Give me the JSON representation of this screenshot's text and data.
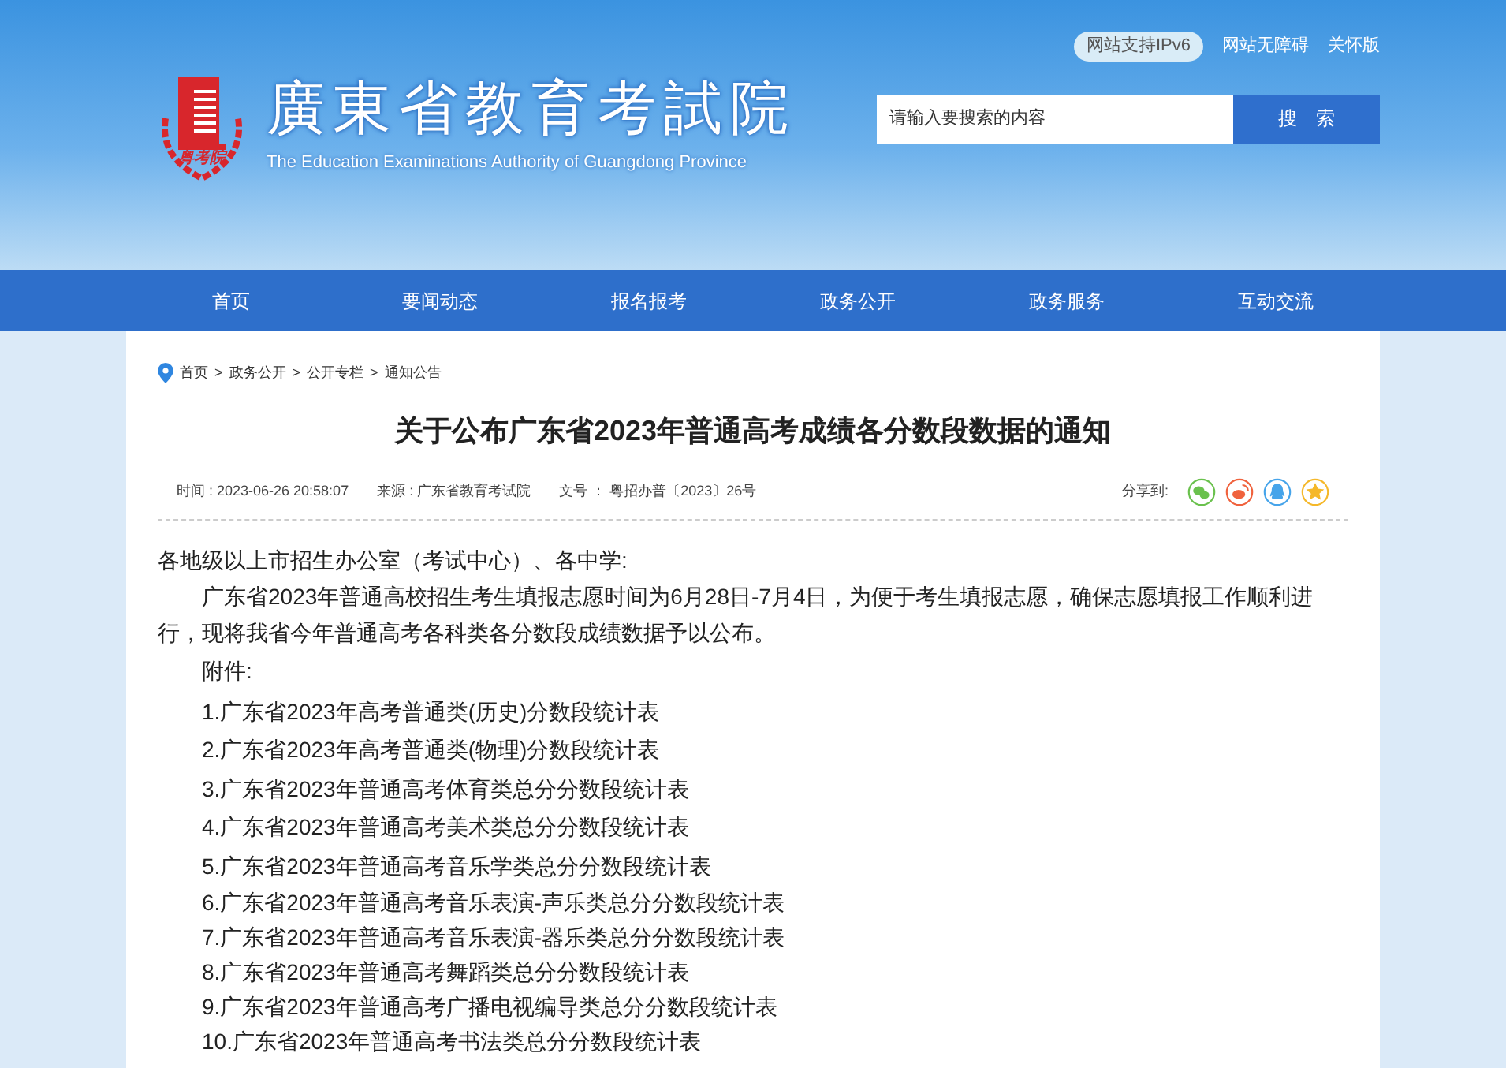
{
  "top_links": [
    {
      "label": "网站支持IPv6",
      "kind": "badge"
    },
    {
      "label": "网站无障碍",
      "kind": "link"
    },
    {
      "label": "关怀版",
      "kind": "link"
    }
  ],
  "logo": {
    "emblem_text": "粤考院",
    "title": "廣東省教育考試院",
    "subtitle": "The Education Examinations Authority of Guangdong Province"
  },
  "search": {
    "placeholder": "请输入要搜索的内容",
    "button": "搜　索"
  },
  "nav": [
    {
      "label": "首页",
      "selected": false
    },
    {
      "label": "要闻动态",
      "selected": false
    },
    {
      "label": "报名报考",
      "selected": false
    },
    {
      "label": "政务公开",
      "selected": false
    },
    {
      "label": "政务服务",
      "selected": false
    },
    {
      "label": "互动交流",
      "selected": false
    }
  ],
  "breadcrumb": [
    "首页",
    "政务公开",
    "公开专栏",
    "通知公告"
  ],
  "breadcrumb_separator": ">",
  "article": {
    "title": "关于公布广东省2023年普通高考成绩各分数段数据的通知",
    "meta": [
      "时间 : 2023-06-26 20:58:07",
      "来源 : 广东省教育考试院",
      "文号 ： 粤招办普〔2023〕26号"
    ],
    "share_label": "分享到:",
    "share": [
      {
        "kind": "wechat",
        "color": "#6ac14d"
      },
      {
        "kind": "weibo",
        "color": "#f0623d"
      },
      {
        "kind": "qq",
        "color": "#46a4ea"
      },
      {
        "kind": "qzone",
        "color": "#f5b82a"
      }
    ],
    "salutation": "各地级以上市招生办公室（考试中心）、各中学:",
    "paragraph": "广东省2023年普通高校招生考生填报志愿时间为6月28日-7月4日，为便于考生填报志愿，确保志愿填报工作顺利进行，现将我省今年普通高考各科类各分数段成绩数据予以公布。",
    "attachments_label": "附件:",
    "attachments": [
      "1.广东省2023年高考普通类(历史)分数段统计表",
      "2.广东省2023年高考普通类(物理)分数段统计表",
      "3.广东省2023年普通高考体育类总分分数段统计表",
      "4.广东省2023年普通高考美术类总分分数段统计表",
      "5.广东省2023年普通高考音乐学类总分分数段统计表",
      "6.广东省2023年普通高考音乐表演-声乐类总分分数段统计表",
      "7.广东省2023年普通高考音乐表演-器乐类总分分数段统计表",
      "8.广东省2023年普通高考舞蹈类总分分数段统计表",
      "9.广东省2023年普通高考广播电视编导类总分分数段统计表",
      "10.广东省2023年普通高考书法类总分分数段统计表"
    ]
  }
}
